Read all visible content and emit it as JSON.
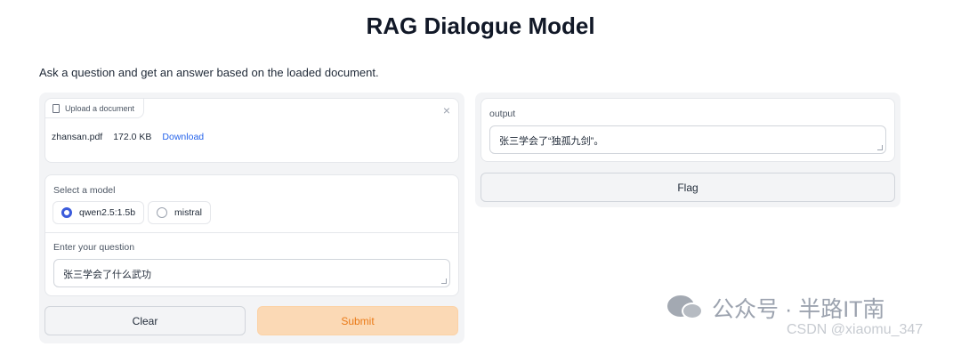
{
  "title": "RAG Dialogue Model",
  "description": "Ask a question and get an answer based on the loaded document.",
  "upload": {
    "label": "Upload a document",
    "close_glyph": "×",
    "file_name": "zhansan.pdf",
    "file_size": "172.0 KB",
    "download_label": "Download"
  },
  "model": {
    "label": "Select a model",
    "options": [
      {
        "label": "qwen2.5:1.5b",
        "selected": true
      },
      {
        "label": "mistral",
        "selected": false
      }
    ]
  },
  "question": {
    "label": "Enter your question",
    "value": "张三学会了什么武功"
  },
  "buttons": {
    "clear": "Clear",
    "submit": "Submit",
    "flag": "Flag"
  },
  "output": {
    "label": "output",
    "value": "张三学会了“独孤九剑”。"
  },
  "watermark": {
    "text": "公众号 · 半路IT南",
    "csdn": "CSDN @xiaomu_347"
  },
  "colors": {
    "accent": "#3b5bdb",
    "submit_bg": "#fbd9b5",
    "submit_text": "#ea7a17",
    "link": "#2563eb"
  }
}
